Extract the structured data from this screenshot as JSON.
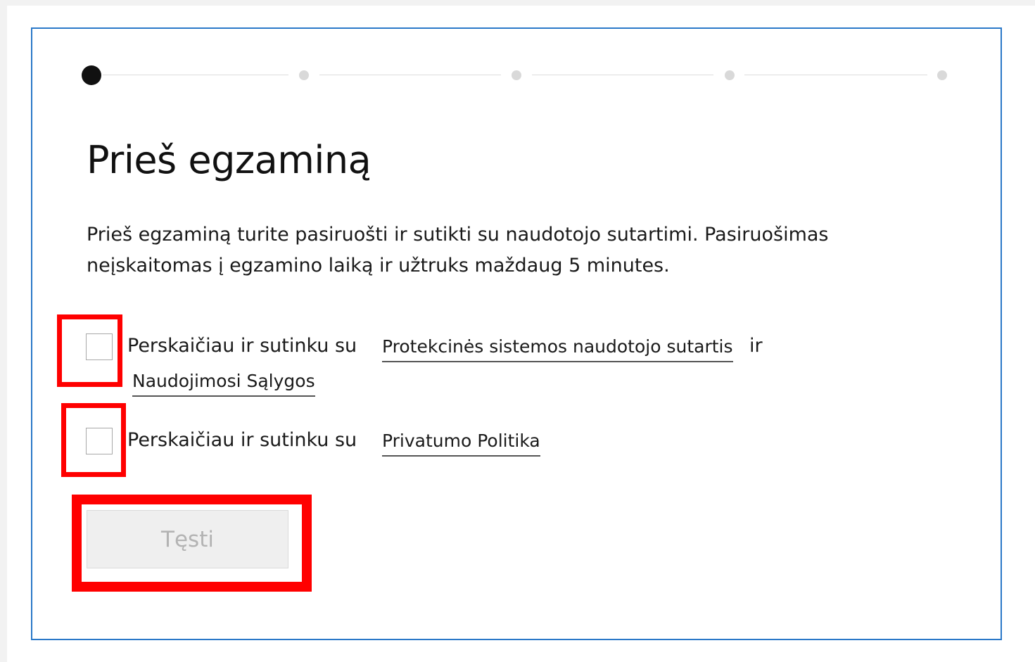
{
  "stepper": {
    "steps": 5,
    "current_step": 1
  },
  "page": {
    "title": "Prieš egzaminą",
    "description": "Prieš egzaminą turite pasiruošti ir sutikti su naudotojo sutartimi. Pasiruošimas neįskaitomas į egzamino laiką ir užtruks maždaug 5 minutes."
  },
  "agreements": [
    {
      "prefix": "Perskaičiau ir sutinku su",
      "link1": "Protekcinės sistemos naudotojo sutartis",
      "conjunction": "ir",
      "link2": "Naudojimosi Sąlygos",
      "checked": false
    },
    {
      "prefix": "Perskaičiau ir sutinku su",
      "link1": "Privatumo Politika",
      "checked": false
    }
  ],
  "continue_button": {
    "label": "Tęsti",
    "enabled": false
  },
  "colors": {
    "card_border": "#2a78c8",
    "highlight": "#ff0000",
    "active_step": "#111111",
    "inactive_step": "#d9d9d9",
    "button_disabled_bg": "#efefef",
    "button_disabled_text": "#b3b3b3"
  }
}
